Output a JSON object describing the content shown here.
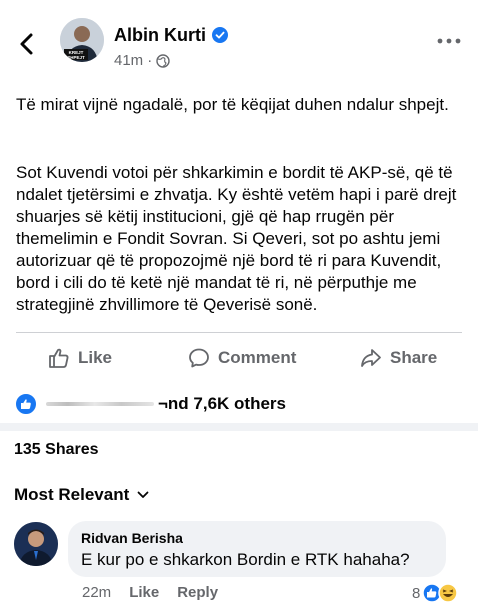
{
  "header": {
    "author": "Albin Kurti",
    "time": "41m",
    "dot": "·",
    "avatar_badge": "KREJT\nSHPEJT"
  },
  "post": {
    "para1": "Të mirat vijnë ngadalë, por të këqijat duhen ndalur shpejt.",
    "para2": "Sot Kuvendi votoi për shkarkimin e bordit të AKP-së, që të ndalet tjetërsimi e zhvatja. Ky është vetëm hapi i parë drejt shuarjes së këtij institucioni, gjë që hap rrugën për themelimin e Fondit Sovran. Si Qeveri, sot po ashtu jemi autorizuar që të propozojmë një bord të ri para Kuvendit, bord i cili do të ketë një mandat të ri, në përputhje me strategjinë zhvillimore të Qeverisë sonë."
  },
  "actions": {
    "like": "Like",
    "comment": "Comment",
    "share": "Share"
  },
  "reactions": {
    "text": "¬nd 7,6K others"
  },
  "shares": "135 Shares",
  "sort": {
    "label": "Most Relevant"
  },
  "comment": {
    "author": "Ridvan Berisha",
    "text": "E kur po e shkarkon Bordin e RTK hahaha?",
    "time": "22m",
    "like": "Like",
    "reply": "Reply",
    "reaction_count": "8"
  },
  "colors": {
    "accent": "#1877f2",
    "muted": "#65676b",
    "bubble": "#f0f2f5"
  }
}
